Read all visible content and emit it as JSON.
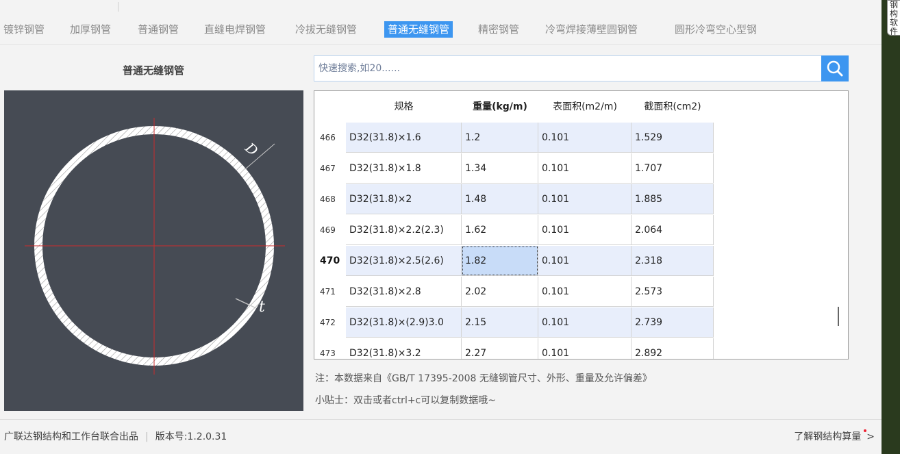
{
  "tabs": [
    {
      "label": "镀锌钢管",
      "active": false
    },
    {
      "label": "加厚钢管",
      "active": false
    },
    {
      "label": "普通钢管",
      "active": false
    },
    {
      "label": "直缝电焊钢管",
      "active": false
    },
    {
      "label": "冷拔无缝钢管",
      "active": false
    },
    {
      "label": "普通无缝钢管",
      "active": true
    },
    {
      "label": "精密钢管",
      "active": false
    },
    {
      "label": "冷弯焊接薄壁圆钢管",
      "active": false
    },
    {
      "label": "圆形冷弯空心型钢",
      "active": false
    }
  ],
  "section_title": "普通无缝钢管",
  "diagram": {
    "label_d": "D",
    "label_t": "t"
  },
  "search": {
    "placeholder": "快速搜索,如20......",
    "icon": "search-icon"
  },
  "table": {
    "columns": [
      "规格",
      "重量(kg/m)",
      "表面积(m2/m)",
      "截面积(cm2)"
    ],
    "rows": [
      {
        "num": "466",
        "spec": "D32(31.8)×1.6",
        "weight": "1.2",
        "surface": "0.101",
        "section": "1.529"
      },
      {
        "num": "467",
        "spec": "D32(31.8)×1.8",
        "weight": "1.34",
        "surface": "0.101",
        "section": "1.707"
      },
      {
        "num": "468",
        "spec": "D32(31.8)×2",
        "weight": "1.48",
        "surface": "0.101",
        "section": "1.885"
      },
      {
        "num": "469",
        "spec": "D32(31.8)×2.2(2.3)",
        "weight": "1.62",
        "surface": "0.101",
        "section": "2.064"
      },
      {
        "num": "470",
        "spec": "D32(31.8)×2.5(2.6)",
        "weight": "1.82",
        "surface": "0.101",
        "section": "2.318"
      },
      {
        "num": "471",
        "spec": "D32(31.8)×2.8",
        "weight": "2.02",
        "surface": "0.101",
        "section": "2.573"
      },
      {
        "num": "472",
        "spec": "D32(31.8)×(2.9)3.0",
        "weight": "2.15",
        "surface": "0.101",
        "section": "2.739"
      },
      {
        "num": "473",
        "spec": "D32(31.8)×3.2",
        "weight": "2.27",
        "surface": "0.101",
        "section": "2.892"
      }
    ],
    "selected_row": "470"
  },
  "notes": {
    "source": "注：本数据来自《GB/T  17395-2008  无缝钢管尺寸、外形、重量及允许偏差》",
    "tip": "小贴士：双击或者ctrl+c可以复制数据哦~"
  },
  "footer": {
    "producer": "广联达钢结构和工作台联合出品",
    "version": "版本号:1.2.0.31",
    "learn_more": "了解钢结构算量"
  },
  "side_widget": {
    "text": "钢构软件"
  },
  "colors": {
    "accent": "#3d96f0",
    "diagram_bg": "#464b54",
    "row_shade": "#e8eefb",
    "selected_cell": "#c8dcf8"
  }
}
